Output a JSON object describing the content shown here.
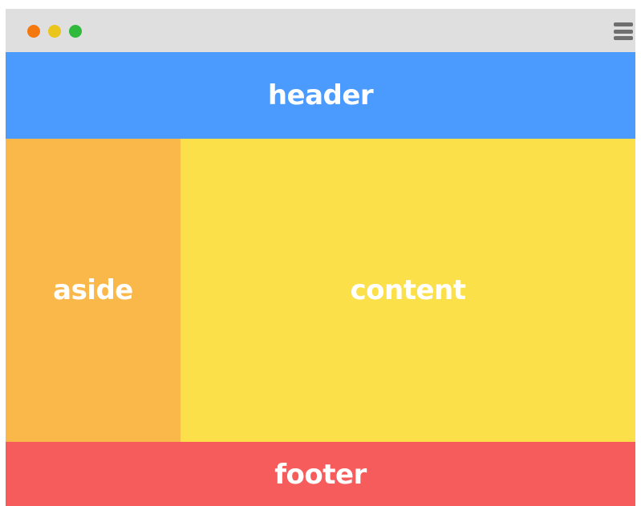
{
  "window": {
    "controls": [
      {
        "name": "close",
        "color": "#f5780f"
      },
      {
        "name": "minimize",
        "color": "#ebc51c"
      },
      {
        "name": "maximize",
        "color": "#2fba3c"
      }
    ],
    "menu_icon": "hamburger-icon",
    "menu_icon_color": "#6f6f6f",
    "titlebar_color": "#dfdfdf"
  },
  "layout": {
    "header": {
      "label": "header",
      "color": "#4b9bff"
    },
    "aside": {
      "label": "aside",
      "color": "#fbb84a"
    },
    "content": {
      "label": "content",
      "color": "#fbe04a"
    },
    "footer": {
      "label": "footer",
      "color": "#f65c5c"
    }
  }
}
